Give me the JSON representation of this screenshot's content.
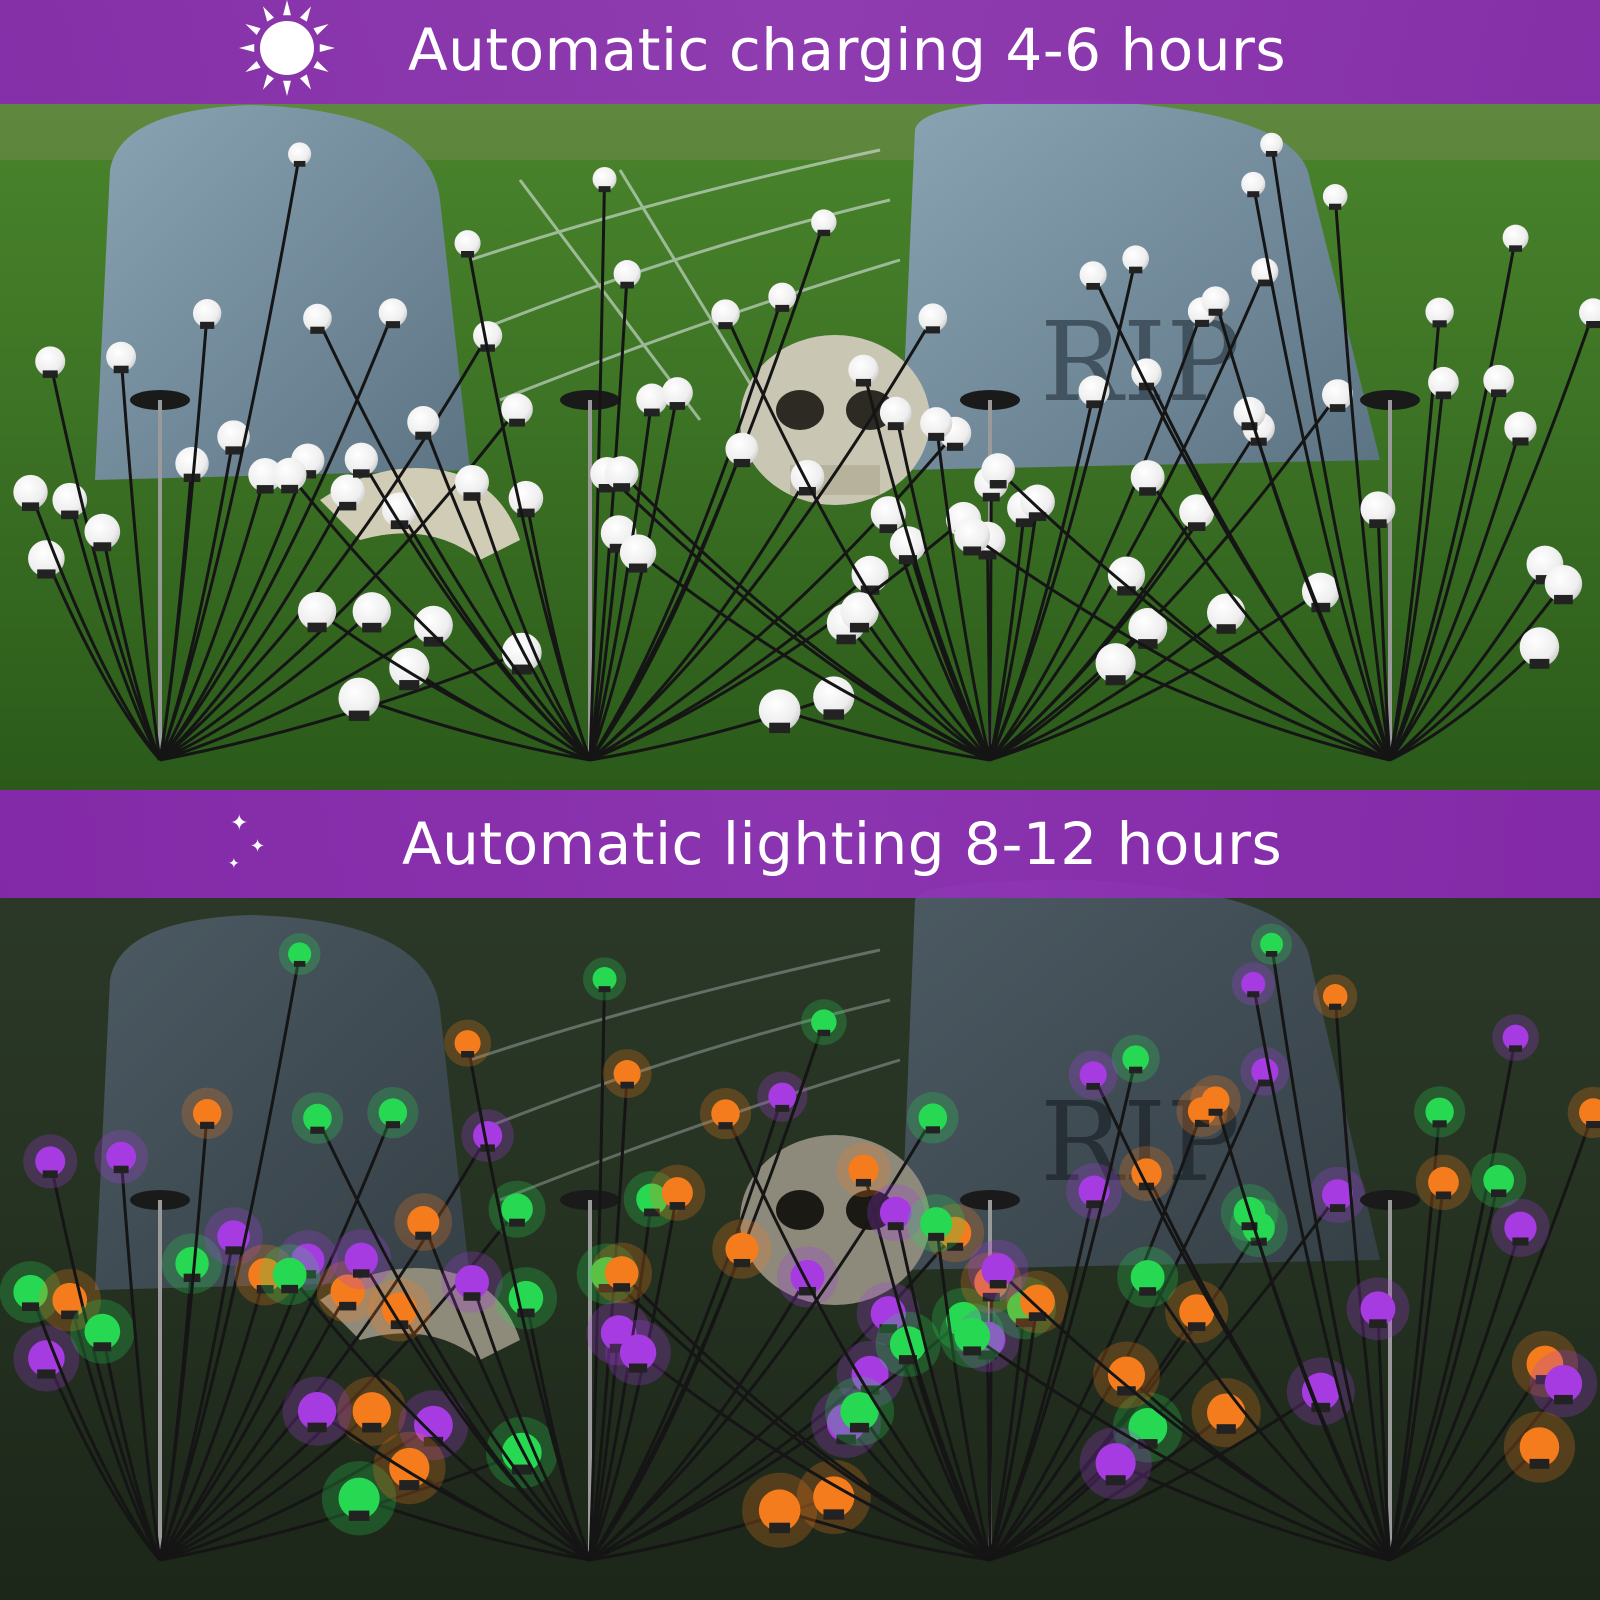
{
  "banners": {
    "day": {
      "text": "Automatic charging 4-6 hours",
      "icon": "sun-icon"
    },
    "night": {
      "text": "Automatic lighting 8-12 hours",
      "icon": "moon-stars-icon"
    }
  },
  "scene": {
    "tombstone_text": "RIP",
    "colors": {
      "banner": "#8a28b2",
      "grass": "#3f7a26",
      "stone": "#6f8797",
      "bulb_day": "#f4f4f4",
      "bulb_purple": "#a73be2",
      "bulb_green": "#27d952",
      "bulb_orange": "#f57c1c"
    }
  }
}
